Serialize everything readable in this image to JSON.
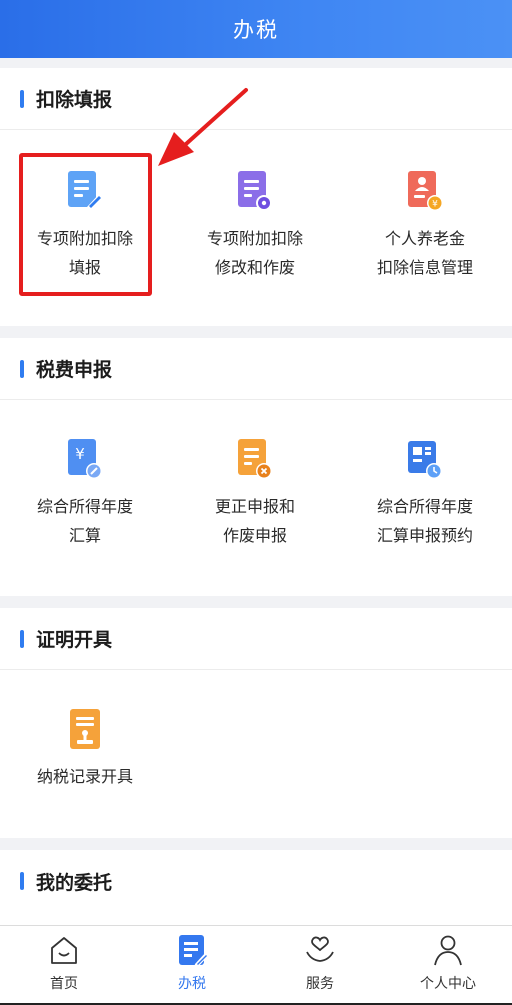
{
  "header": {
    "title": "办税"
  },
  "sections": [
    {
      "title": "扣除填报",
      "items": [
        {
          "line1": "专项附加扣除",
          "line2": "填报",
          "icon": "form-edit-icon"
        },
        {
          "line1": "专项附加扣除",
          "line2": "修改和作废",
          "icon": "form-settings-icon"
        },
        {
          "line1": "个人养老金",
          "line2": "扣除信息管理",
          "icon": "pension-yen-icon"
        }
      ]
    },
    {
      "title": "税费申报",
      "items": [
        {
          "line1": "综合所得年度",
          "line2": "汇算",
          "icon": "yen-doc-icon"
        },
        {
          "line1": "更正申报和",
          "line2": "作废申报",
          "icon": "doc-cancel-icon"
        },
        {
          "line1": "综合所得年度",
          "line2": "汇算申报预约",
          "icon": "calendar-clock-icon"
        }
      ]
    },
    {
      "title": "证明开具",
      "items": [
        {
          "line1": "纳税记录开具",
          "line2": "",
          "icon": "stamp-doc-icon"
        }
      ]
    },
    {
      "title": "我的委托",
      "items": []
    }
  ],
  "tabs": [
    {
      "label": "首页",
      "icon": "home-icon",
      "active": false
    },
    {
      "label": "办税",
      "icon": "tax-doc-icon",
      "active": true
    },
    {
      "label": "服务",
      "icon": "heart-hand-icon",
      "active": false
    },
    {
      "label": "个人中心",
      "icon": "person-icon",
      "active": false
    }
  ],
  "colors": {
    "brand": "#2f7cf0",
    "highlight": "#e51e1e",
    "active_tab": "#3478ef"
  }
}
